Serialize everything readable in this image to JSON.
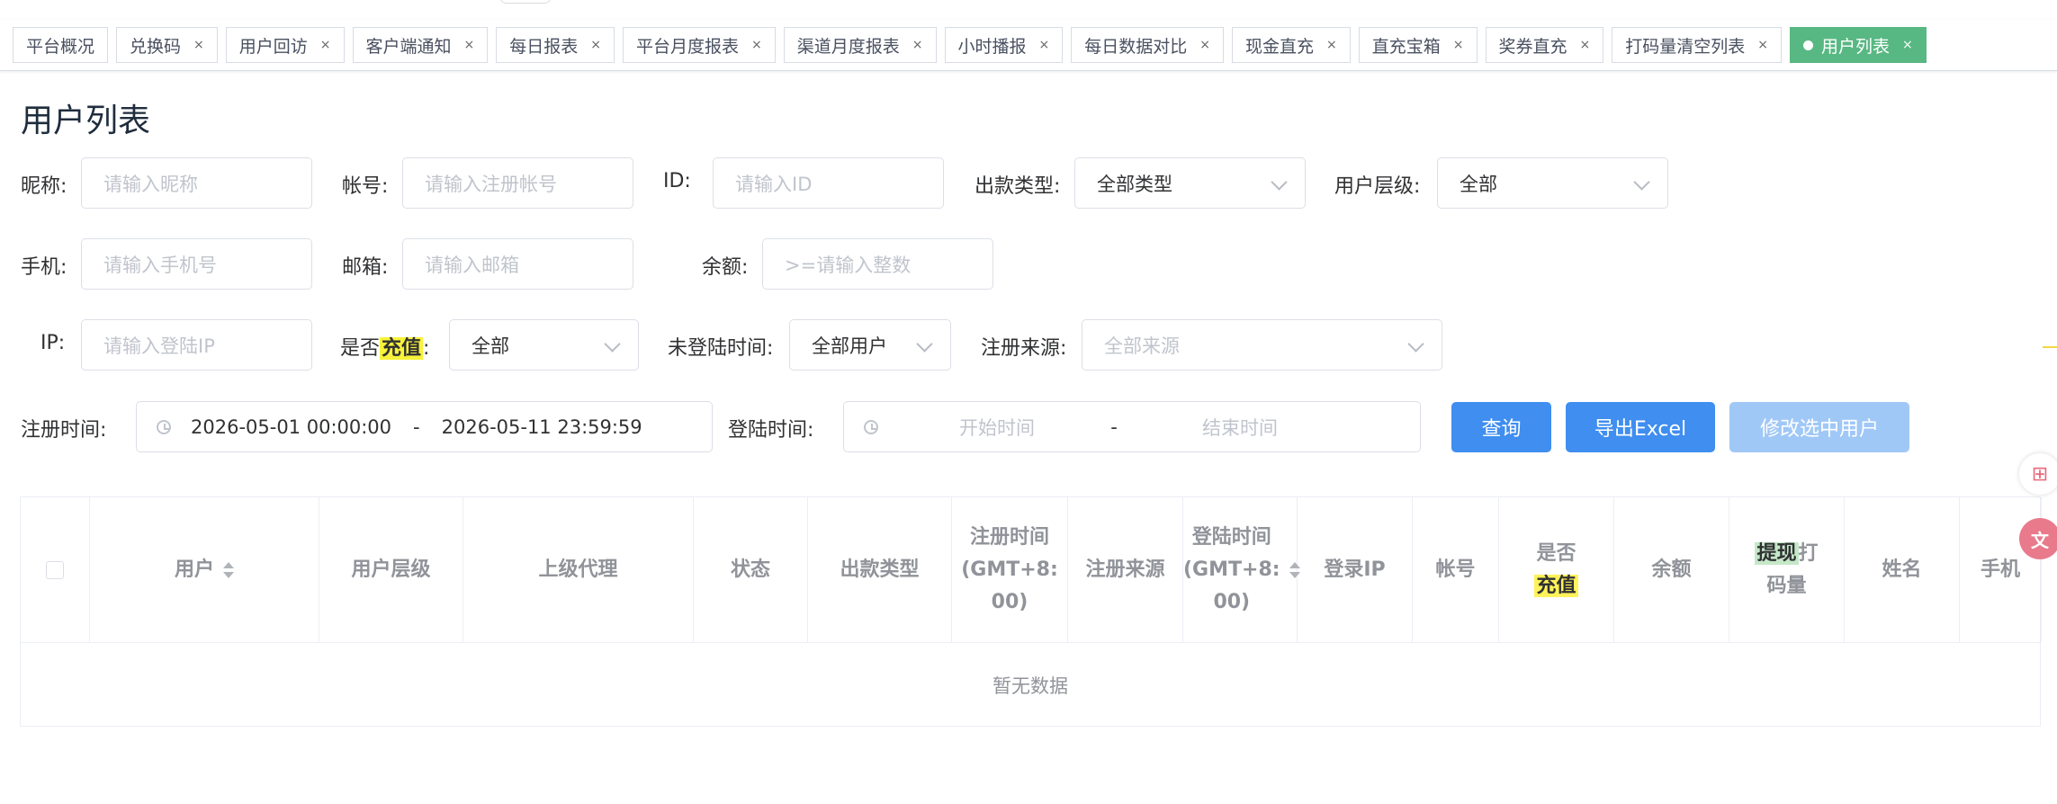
{
  "tags": [
    {
      "label": "平台概况",
      "closable": false
    },
    {
      "label": "兑换码",
      "closable": true
    },
    {
      "label": "用户回访",
      "closable": true
    },
    {
      "label": "客户端通知",
      "closable": true
    },
    {
      "label": "每日报表",
      "closable": true
    },
    {
      "label": "平台月度报表",
      "closable": true
    },
    {
      "label": "渠道月度报表",
      "closable": true
    },
    {
      "label": "小时播报",
      "closable": true
    },
    {
      "label": "每日数据对比",
      "closable": true
    },
    {
      "label": "现金直充",
      "closable": true
    },
    {
      "label": "直充宝箱",
      "closable": true
    },
    {
      "label": "奖券直充",
      "closable": true
    },
    {
      "label": "打码量清空列表",
      "closable": true
    },
    {
      "label": "用户列表",
      "closable": true,
      "active": true
    }
  ],
  "close_glyph": "×",
  "page_title": "用户列表",
  "filters": {
    "nickname": {
      "label": "昵称:",
      "placeholder": "请输入昵称"
    },
    "account": {
      "label": "帐号:",
      "placeholder": "请输入注册帐号"
    },
    "id": {
      "label": "ID:",
      "placeholder": "请输入ID"
    },
    "payout_type": {
      "label": "出款类型:",
      "value": "全部类型"
    },
    "user_level": {
      "label": "用户层级:",
      "value": "全部"
    },
    "phone": {
      "label": "手机:",
      "placeholder": "请输入手机号"
    },
    "email": {
      "label": "邮箱:",
      "placeholder": "请输入邮箱"
    },
    "balance": {
      "label": "余额:",
      "placeholder": ">=请输入整数"
    },
    "ip": {
      "label": "IP:",
      "placeholder": "请输入登陆IP"
    },
    "recharged": {
      "label_pre": "是否",
      "label_hl": "充值",
      "label_post": ":",
      "value": "全部"
    },
    "inactive": {
      "label": "未登陆时间:",
      "value": "全部用户"
    },
    "reg_source": {
      "label": "注册来源:",
      "placeholder": "全部来源"
    },
    "reg_time": {
      "label": "注册时间:",
      "start": "2026-05-01 00:00:00",
      "sep": "-",
      "end": "2026-05-11 23:59:59"
    },
    "login_time": {
      "label": "登陆时间:",
      "start_placeholder": "开始时间",
      "sep": "-",
      "end_placeholder": "结束时间"
    }
  },
  "buttons": {
    "query": "查询",
    "export": "导出Excel",
    "modify": "修改选中用户"
  },
  "table": {
    "columns": [
      {
        "label": "用户"
      },
      {
        "label": "用户层级"
      },
      {
        "label": "上级代理"
      },
      {
        "label": "状态"
      },
      {
        "label": "出款类型"
      },
      {
        "label": "注册时间\n(GMT+8:\n00)"
      },
      {
        "label": "注册来源"
      },
      {
        "label": "登陆时间\n(GMT+8:\n00)"
      },
      {
        "label": "登录IP"
      },
      {
        "label": "帐号"
      },
      {
        "label_pre": "是否",
        "label_hl": "充值"
      },
      {
        "label": "余额"
      },
      {
        "label_hl": "提现",
        "label_post": "打\n码量"
      },
      {
        "label": "姓名"
      },
      {
        "label": "手机"
      }
    ],
    "empty_text": "暂无数据"
  },
  "colors": {
    "primary": "#3f8ef0",
    "active_tag": "#58b883",
    "highlight": "#f7f23a"
  }
}
